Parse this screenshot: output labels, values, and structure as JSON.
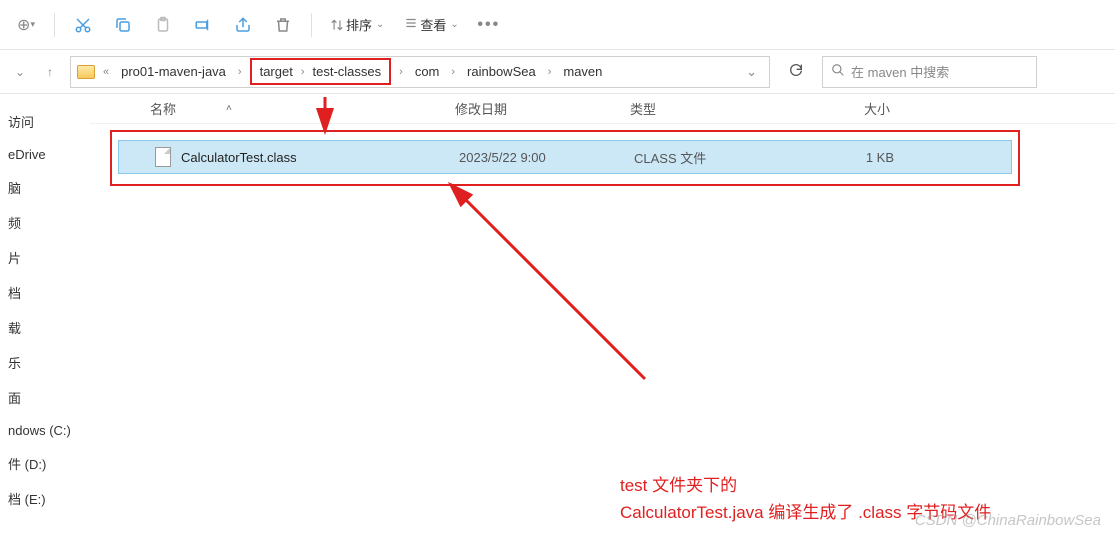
{
  "toolbar": {
    "sort_label": "排序",
    "view_label": "查看"
  },
  "nav": {
    "back": "‹",
    "forward": "›",
    "up": "↑"
  },
  "breadcrumb": {
    "overflow": "«",
    "items": [
      "pro01-maven-java",
      "target",
      "test-classes",
      "com",
      "rainbowSea",
      "maven"
    ]
  },
  "search": {
    "placeholder": "在 maven 中搜索"
  },
  "sidebar": {
    "items": [
      "访问",
      "eDrive",
      "脑",
      "频",
      "片",
      "档",
      "载",
      "乐",
      "面",
      "ndows (C:)",
      "件 (D:)",
      "档 (E:)"
    ]
  },
  "columns": {
    "name": "名称",
    "date": "修改日期",
    "type": "类型",
    "size": "大小"
  },
  "files": [
    {
      "name": "CalculatorTest.class",
      "date": "2023/5/22 9:00",
      "type": "CLASS 文件",
      "size": "1 KB"
    }
  ],
  "annotation": {
    "line1": "test 文件夹下的",
    "line2": "CalculatorTest.java 编译生成了 .class 字节码文件"
  },
  "watermark": "CSDN @ChinaRainbowSea"
}
